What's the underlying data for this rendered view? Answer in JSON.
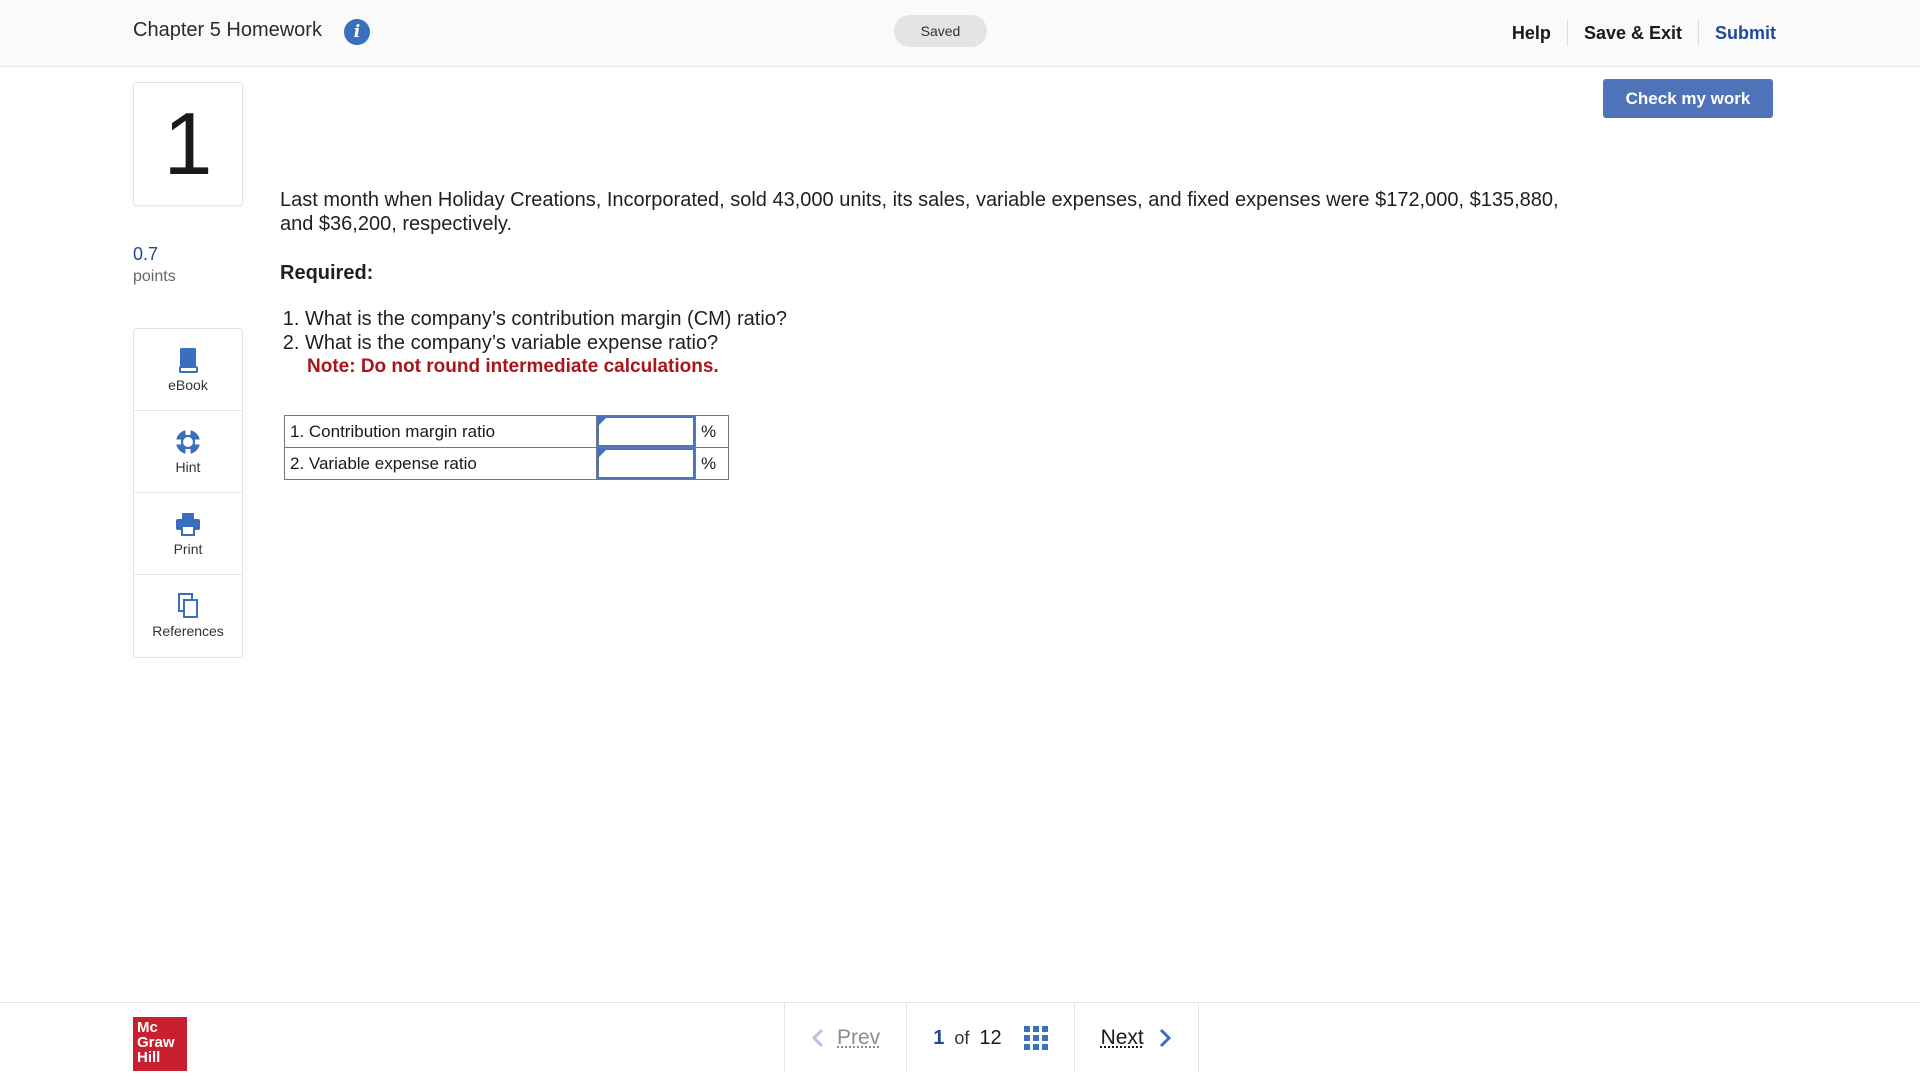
{
  "header": {
    "title": "Chapter 5 Homework",
    "saved_label": "Saved",
    "help": "Help",
    "save_exit": "Save & Exit",
    "submit": "Submit"
  },
  "question": {
    "number": "1",
    "points": "0.7",
    "points_label": "points",
    "stem": "Last month when Holiday Creations, Incorporated, sold 43,000 units, its sales, variable expenses, and fixed expenses were $172,000, $135,880, and $36,200, respectively.",
    "required": "Required:",
    "items": [
      "What is the company’s contribution margin (CM) ratio?",
      "What is the company’s variable expense ratio?"
    ],
    "note": "Note: Do not round intermediate calculations."
  },
  "answer_table": {
    "rows": [
      {
        "label": "1. Contribution margin ratio",
        "value": "",
        "unit": "%"
      },
      {
        "label": "2. Variable expense ratio",
        "value": "",
        "unit": "%"
      }
    ]
  },
  "tools": [
    {
      "label": "eBook",
      "icon": "book-icon"
    },
    {
      "label": "Hint",
      "icon": "lifebuoy-icon"
    },
    {
      "label": "Print",
      "icon": "printer-icon"
    },
    {
      "label": "References",
      "icon": "copy-icon"
    }
  ],
  "check_button": "Check my work",
  "footer": {
    "logo_lines": [
      "Mc",
      "Graw",
      "Hill"
    ],
    "prev": "Prev",
    "current": "1",
    "of": "of",
    "total": "12",
    "next": "Next"
  },
  "colors": {
    "accent": "#4f73b9",
    "link": "#1f4b96",
    "note_red": "#a8151b",
    "brand_red": "#c8202e"
  }
}
